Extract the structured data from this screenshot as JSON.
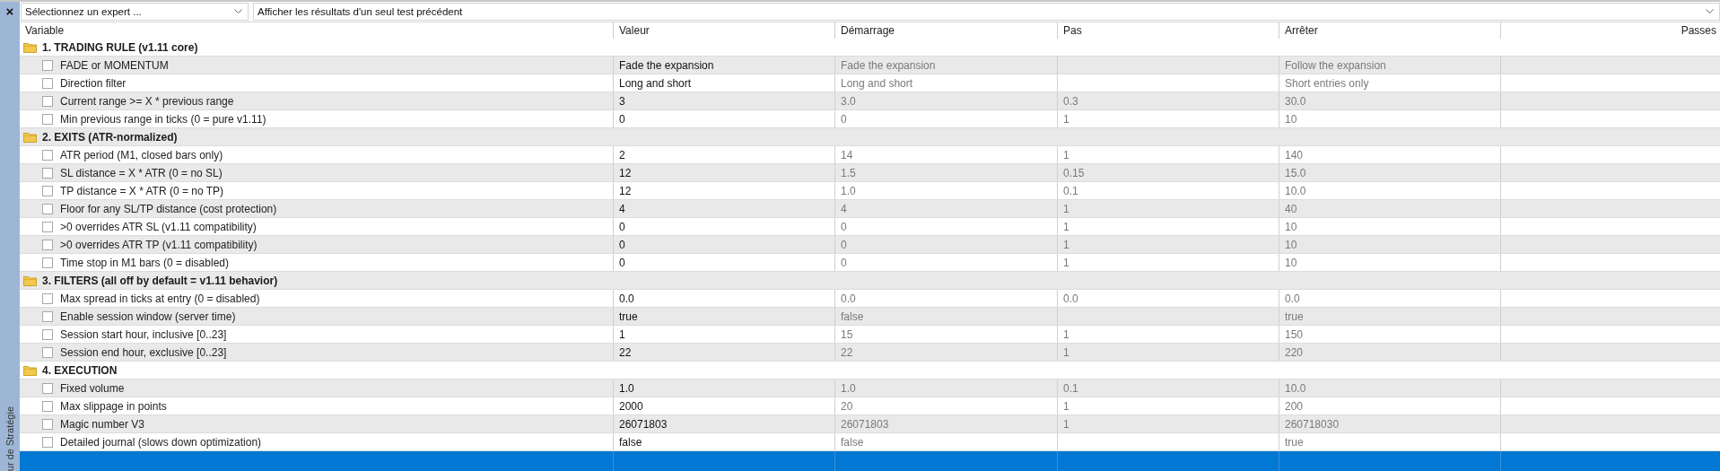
{
  "sidebar": {
    "close": "×",
    "title": "ur de Stratégie"
  },
  "toolbar": {
    "expert_select": {
      "value": "Sélectionnez un expert ..."
    },
    "results_select": {
      "value": "Afficher les résultats d'un seul test précédent"
    }
  },
  "table": {
    "columns": [
      "Variable",
      "Valeur",
      "Démarrage",
      "Pas",
      "Arrêter",
      "Passes"
    ],
    "groups": [
      {
        "title": "1. TRADING RULE (v1.11 core)",
        "params": [
          {
            "name": "FADE or MOMENTUM",
            "checked": false,
            "selected": false,
            "value": "Fade the expansion",
            "start": "Fade the expansion",
            "stop": "Follow the expansion"
          },
          {
            "name": "Direction filter",
            "checked": false,
            "selected": false,
            "value": "Long and short",
            "start": "Long and short",
            "stop": "Short entries only"
          },
          {
            "name": "Current range >= X * previous range",
            "checked": false,
            "selected": false,
            "value": "3",
            "start": "3.0",
            "step": "0.3",
            "stop": "30.0"
          },
          {
            "name": "Min previous range in ticks (0 = pure v1.11)",
            "checked": false,
            "selected": false,
            "value": "0",
            "start": "0",
            "step": "1",
            "stop": "10"
          }
        ]
      },
      {
        "title": "2. EXITS (ATR-normalized)",
        "params": [
          {
            "name": "ATR period (M1, closed bars only)",
            "checked": false,
            "selected": false,
            "value": "2",
            "start": "14",
            "step": "1",
            "stop": "140"
          },
          {
            "name": "SL distance = X * ATR (0 = no SL)",
            "checked": false,
            "selected": false,
            "value": "12",
            "start": "1.5",
            "step": "0.15",
            "stop": "15.0"
          },
          {
            "name": "TP distance = X * ATR (0 = no TP)",
            "checked": false,
            "selected": false,
            "value": "12",
            "start": "1.0",
            "step": "0.1",
            "stop": "10.0"
          },
          {
            "name": "Floor for any SL/TP distance (cost protection)",
            "checked": false,
            "selected": false,
            "value": "4",
            "start": "4",
            "step": "1",
            "stop": "40"
          },
          {
            "name": ">0 overrides ATR SL (v1.11 compatibility)",
            "checked": false,
            "selected": false,
            "value": "0",
            "start": "0",
            "step": "1",
            "stop": "10"
          },
          {
            "name": ">0 overrides ATR TP (v1.11 compatibility)",
            "checked": false,
            "selected": false,
            "value": "0",
            "start": "0",
            "step": "1",
            "stop": "10"
          },
          {
            "name": "Time stop in M1 bars (0 = disabled)",
            "checked": false,
            "selected": false,
            "value": "0",
            "start": "0",
            "step": "1",
            "stop": "10"
          }
        ]
      },
      {
        "title": "3. FILTERS (all off by default = v1.11 behavior)",
        "params": [
          {
            "name": "Max spread in ticks at entry (0 = disabled)",
            "checked": false,
            "selected": false,
            "value": "0.0",
            "start": "0.0",
            "step": "0.0",
            "stop": "0.0"
          },
          {
            "name": "Enable session window (server time)",
            "checked": false,
            "selected": false,
            "value": "true",
            "start": "false",
            "stop": "true"
          },
          {
            "name": "Session start hour, inclusive [0..23]",
            "checked": false,
            "selected": false,
            "value": "1",
            "start": "15",
            "step": "1",
            "stop": "150"
          },
          {
            "name": "Session end hour, exclusive [0..23]",
            "checked": false,
            "selected": false,
            "value": "22",
            "start": "22",
            "step": "1",
            "stop": "220"
          }
        ]
      },
      {
        "title": "4. EXECUTION",
        "params": [
          {
            "name": "Fixed volume",
            "checked": false,
            "selected": false,
            "value": "1.0",
            "start": "1.0",
            "step": "0.1",
            "stop": "10.0"
          },
          {
            "name": "Max slippage in points",
            "checked": false,
            "selected": false,
            "value": "2000",
            "start": "20",
            "step": "1",
            "stop": "200"
          },
          {
            "name": "Magic number V3",
            "checked": false,
            "selected": false,
            "value": "26071803",
            "start": "26071803",
            "step": "1",
            "stop": "260718030"
          },
          {
            "name": "Detailed journal (slows down optimization)",
            "checked": false,
            "selected": false,
            "value": "false",
            "start": "false",
            "stop": "true"
          }
        ]
      }
    ],
    "partial_row": {
      "selected": true
    }
  }
}
